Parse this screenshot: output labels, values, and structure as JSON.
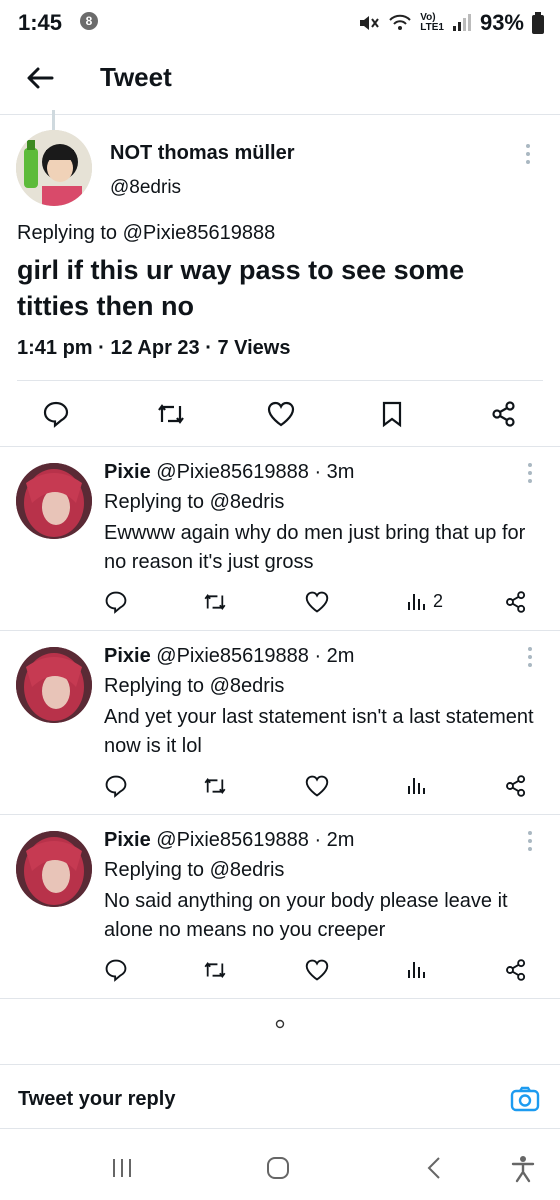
{
  "status_bar": {
    "time": "1:45",
    "notification_count": "8",
    "network_label_top": "Vo)",
    "network_label_bottom": "LTE1",
    "battery": "93%"
  },
  "header": {
    "title": "Tweet"
  },
  "main_tweet": {
    "name": "NOT thomas müller",
    "handle": "@8edris",
    "replying_to": "Replying to @Pixie85619888",
    "text": "girl if this ur way pass to see some titties then no",
    "meta": "1:41 pm · 12 Apr 23 · 7 Views"
  },
  "replies": [
    {
      "name": "Pixie",
      "handle_time": " @Pixie85619888 · 3m",
      "replying_to": "Replying to @8edris",
      "text": "Ewwww again why do men just bring that up for no reason it's just gross",
      "views": "2"
    },
    {
      "name": "Pixie",
      "handle_time": " @Pixie85619888 · 2m",
      "replying_to": "Replying to @8edris",
      "text": "And yet your last statement isn't a last statement now is it lol",
      "views": ""
    },
    {
      "name": "Pixie",
      "handle_time": " @Pixie85619888 · 2m",
      "replying_to": "Replying to @8edris",
      "text": "No said anything on your body please leave it alone no means no you creeper",
      "views": ""
    }
  ],
  "reply_box": {
    "placeholder": "Tweet your reply"
  },
  "colors": {
    "accent": "#1d9bf0",
    "icon_gray": "#536471",
    "divider": "#e1e5ea"
  }
}
